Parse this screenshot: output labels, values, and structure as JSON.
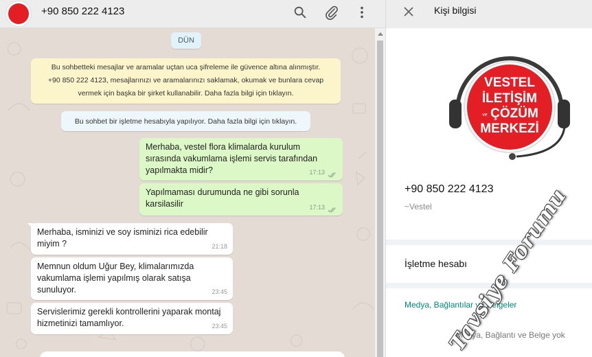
{
  "chat_header": {
    "title": "+90 850 222 4123",
    "icons": [
      "search-icon",
      "attach-icon",
      "menu-icon"
    ]
  },
  "date_label": "DÜN",
  "system_messages": {
    "encryption_lines": [
      "Bu sohbetteki mesajlar ve aramalar uçtan uca şifreleme ile güvence altına alınmıştır.",
      "+90 850 222 4123, mesajlarınızı ve aramalarınızı saklamak, okumak ve bunlara cevap",
      "vermek için başka bir şirket kullanabilir. Daha fazla bilgi için tıklayın."
    ],
    "business": "Bu sohbet bir işletme hesabıyla yapılıyor. Daha fazla bilgi için tıklayın."
  },
  "messages": [
    {
      "dir": "out",
      "lines": [
        "Merhaba, vestel flora klimalarda kurulum",
        "sırasında vakumlama işlemi servis tarafından",
        "yapılmakta midir?"
      ],
      "time": "17:13"
    },
    {
      "dir": "out",
      "lines": [
        "Yapılmaması durumunda ne gibi sorunla",
        "karsilasilir"
      ],
      "time": "17:13"
    },
    {
      "dir": "in",
      "lines": [
        "Merhaba, isminizi ve soy isminizi rica edebilir",
        "miyim ?"
      ],
      "time": "21:18"
    },
    {
      "dir": "in",
      "lines": [
        "Memnun oldum Uğur  Bey, klimalarımızda",
        "vakumlama işlemi yapılmış  olarak satışa",
        "sunuluyor."
      ],
      "time": "23:45"
    },
    {
      "dir": "in",
      "lines": [
        "Servislerimiz gerekli kontrollerini yaparak montaj",
        "hizmetinizi tamamlıyor."
      ],
      "time": "23:45"
    }
  ],
  "info_panel": {
    "title": "Kişi bilgisi",
    "logo_lines": [
      "VESTEL",
      "İLETİŞİM",
      "ÇÖZÜM",
      "MERKEZİ"
    ],
    "logo_small": "ve",
    "phone": "+90 850 222 4123",
    "name": "~Vestel",
    "business_label": "İşletme hesabı",
    "media_link": "Medya, Bağlantılar ve Belgeler",
    "media_none": "Medya, Bağlantı ve Belge yok"
  },
  "watermark": "Tavsiye Forumu",
  "colors": {
    "outgoing_bubble": "#dcf8c6",
    "incoming_bubble": "#ffffff",
    "system_yellow": "#fcf4cb",
    "brand_red": "#e31e24",
    "link_teal": "#00897b"
  }
}
